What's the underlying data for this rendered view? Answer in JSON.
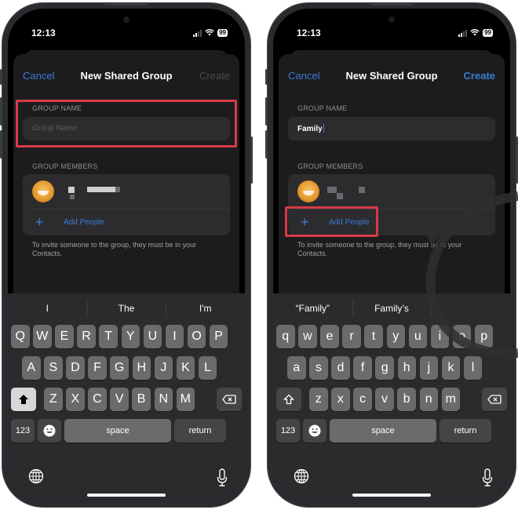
{
  "panels": [
    {
      "status": {
        "time": "12:13",
        "battery": "99"
      },
      "nav": {
        "cancel": "Cancel",
        "title": "New Shared Group",
        "create": "Create",
        "create_enabled": false
      },
      "group_name": {
        "label": "GROUP NAME",
        "placeholder": "Group Name",
        "value": ""
      },
      "group_members": {
        "label": "GROUP MEMBERS",
        "add_people": "Add People"
      },
      "hint": "To invite someone to the group, they must be in your Contacts.",
      "highlight": "group-name-section",
      "keyboard": {
        "suggestions": [
          "I",
          "The",
          "I'm"
        ],
        "row1": [
          "Q",
          "W",
          "E",
          "R",
          "T",
          "Y",
          "U",
          "I",
          "O",
          "P"
        ],
        "row2": [
          "A",
          "S",
          "D",
          "F",
          "G",
          "H",
          "J",
          "K",
          "L"
        ],
        "row3": [
          "Z",
          "X",
          "C",
          "V",
          "B",
          "N",
          "M"
        ],
        "numbers": "123",
        "space": "space",
        "return": "return",
        "shift_active": true
      }
    },
    {
      "status": {
        "time": "12:13",
        "battery": "99"
      },
      "nav": {
        "cancel": "Cancel",
        "title": "New Shared Group",
        "create": "Create",
        "create_enabled": true
      },
      "group_name": {
        "label": "GROUP NAME",
        "placeholder": "Group Name",
        "value": "Family"
      },
      "group_members": {
        "label": "GROUP MEMBERS",
        "add_people": "Add People"
      },
      "hint": "To invite someone to the group, they must be in your Contacts.",
      "highlight": "add-people-row",
      "keyboard": {
        "suggestions": [
          "“Family”",
          "Family’s"
        ],
        "row1": [
          "q",
          "w",
          "e",
          "r",
          "t",
          "y",
          "u",
          "i",
          "o",
          "p"
        ],
        "row2": [
          "a",
          "s",
          "d",
          "f",
          "g",
          "h",
          "j",
          "k",
          "l"
        ],
        "row3": [
          "z",
          "x",
          "c",
          "v",
          "b",
          "n",
          "m"
        ],
        "numbers": "123",
        "space": "space",
        "return": "return",
        "shift_active": false
      }
    }
  ],
  "colors": {
    "accent": "#3a7bd5",
    "highlight": "#d63b47",
    "sheet": "#1c1c1e"
  }
}
